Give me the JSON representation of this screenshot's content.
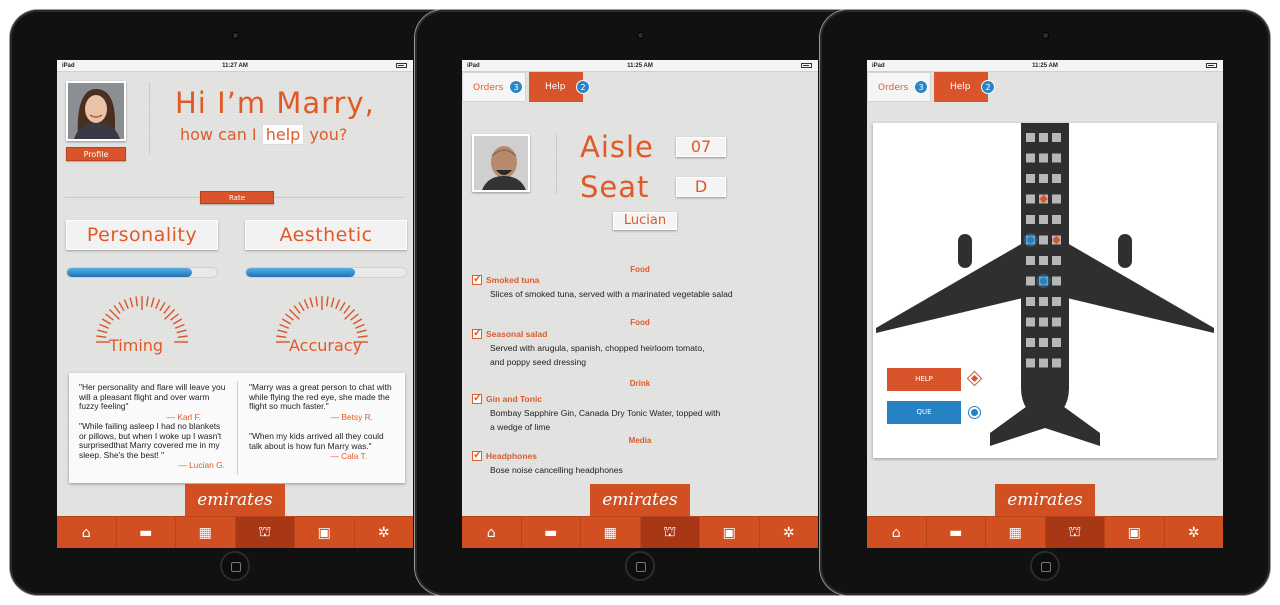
{
  "status": {
    "device": "iPad",
    "screen1_time": "11:27 AM",
    "screen2_time": "11:25 AM",
    "screen3_time": "11:25 AM"
  },
  "brand": "emirates",
  "tabbar": {
    "icons": [
      "home-icon",
      "ticket-icon",
      "map-icon",
      "service-bell-icon",
      "luggage-icon",
      "gear-icon"
    ],
    "active_index": 3
  },
  "screen1": {
    "greeting": "Hi I’m Marry,",
    "question_prefix": "how can I",
    "question_highlight": "help",
    "question_suffix": "you?",
    "profile_button": "Profile",
    "rate_button": "Rate",
    "metrics": [
      {
        "label": "Personality",
        "progress": 0.83
      },
      {
        "label": "Aesthetic",
        "progress": 0.68
      }
    ],
    "gauges": [
      {
        "label": "Timing"
      },
      {
        "label": "Accuracy"
      }
    ],
    "quotes": [
      {
        "text": "\"Her personality and flare will leave you will a pleasant flight and over warm fuzzy feeling\"",
        "author": "— Karl F."
      },
      {
        "text": "\"While failing asleep I had no blankets or pillows, but when I woke up I wasn't surprisedthat Marry covered me in my sleep. She's the best! \"",
        "author": "— Lucian G."
      },
      {
        "text": "\"Marry was a great person to chat with while flying the red eye, she made the flight so much faster.\"",
        "author": "— Betsy R."
      },
      {
        "text": "\"When my kids arrived all they could talk about is how fun Marry was.\"",
        "author": "— Cala T."
      }
    ],
    "colors": {
      "accent": "#e05a28",
      "progress_bar": "#2b86c8"
    }
  },
  "top_tabs": {
    "orders_label": "Orders",
    "orders_count": "3",
    "help_label": "Help",
    "help_count": "2"
  },
  "screen2": {
    "aisle_label": "Aisle",
    "aisle_value": "07",
    "seat_label": "Seat",
    "seat_value": "D",
    "passenger_name": "Lucian",
    "orders": [
      {
        "category": "Food",
        "title": "Smoked tuna",
        "desc": "Slices of smoked tuna, served with a marinated vegetable salad"
      },
      {
        "category": "Food",
        "title": "Seasonal salad",
        "desc_line1": "Served with arugula, spanish, chopped heirloom tomato,",
        "desc_line2": "and poppy seed dressing"
      },
      {
        "category": "Drink",
        "title": "Gin and Tonic",
        "desc_line1": "Bombay Sapphire Gin, Canada Dry Tonic Water, topped with",
        "desc_line2": " a wedge of lime"
      },
      {
        "category": "Media",
        "title": "Headphones",
        "desc": "Bose noise cancelling headphones"
      }
    ]
  },
  "screen3": {
    "legend_help": "HELP",
    "legend_que": "QUE",
    "seat_rows": 12,
    "seat_cols": 3,
    "help_seats": [
      [
        3,
        1
      ],
      [
        5,
        2
      ]
    ],
    "que_seats": [
      [
        5,
        0
      ],
      [
        7,
        1
      ]
    ],
    "colors": {
      "help": "#d9542a",
      "que": "#2582c3",
      "plane": "#2f2f2f",
      "seat": "#b7b7b7"
    }
  }
}
